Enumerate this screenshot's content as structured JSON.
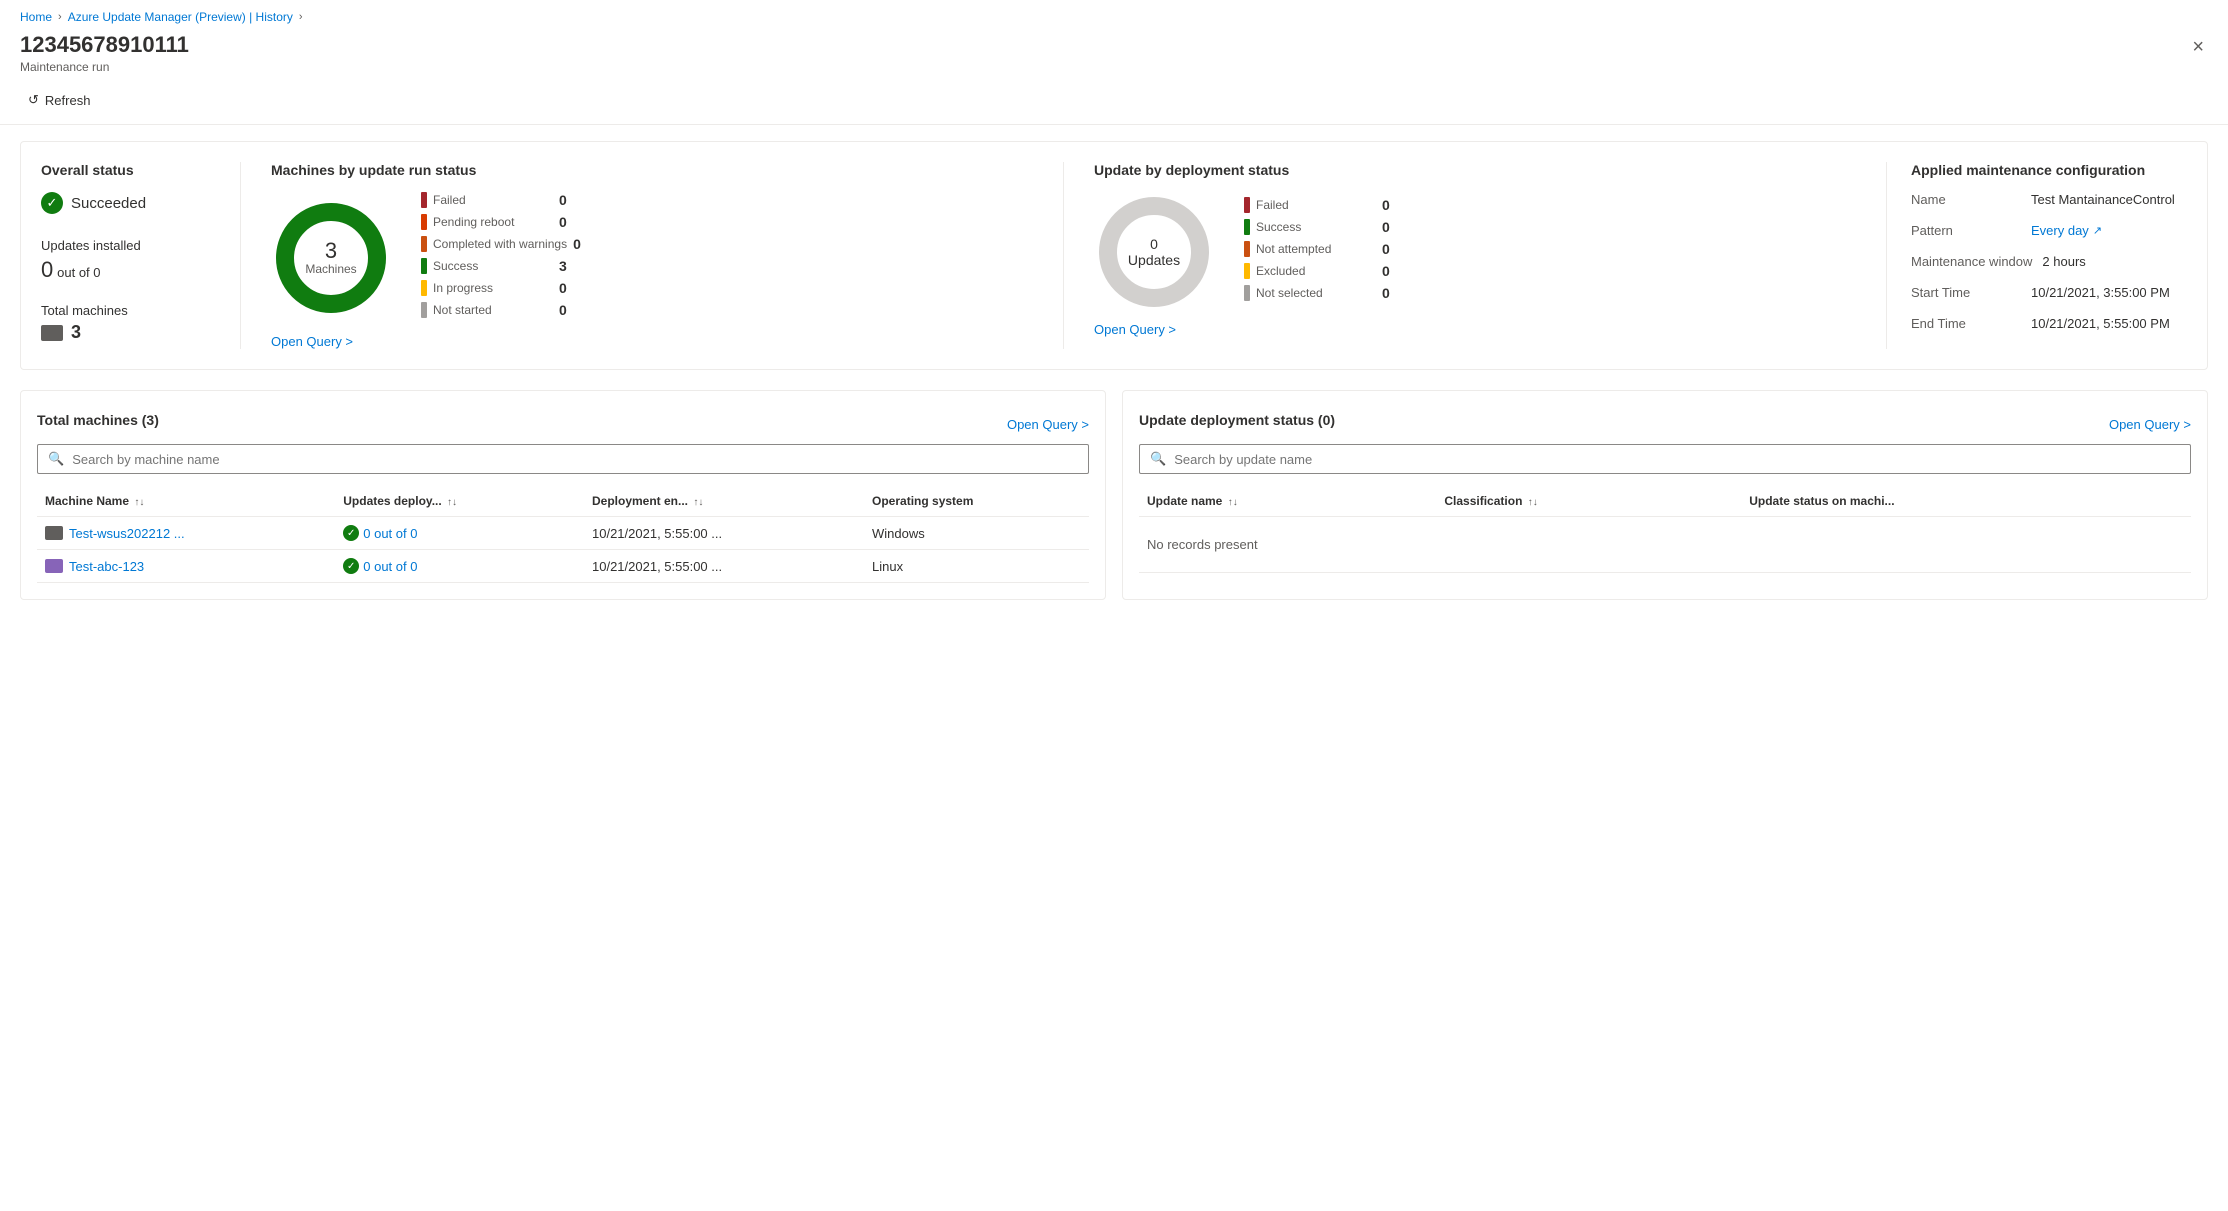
{
  "breadcrumb": {
    "home": "Home",
    "parent": "Azure Update Manager (Preview) | History"
  },
  "header": {
    "title": "12345678910111",
    "subtitle": "Maintenance run",
    "close_label": "×"
  },
  "toolbar": {
    "refresh_label": "Refresh"
  },
  "overall_status": {
    "section_title": "Overall status",
    "status_text": "Succeeded",
    "updates_installed_label": "Updates installed",
    "updates_count": "0",
    "updates_out_of": "out of 0",
    "total_machines_label": "Total machines",
    "total_machines_count": "3"
  },
  "machines_by_status": {
    "section_title": "Machines by update run status",
    "donut_center_num": "3",
    "donut_center_text": "Machines",
    "statuses": [
      {
        "label": "Failed",
        "count": "0",
        "color": "red"
      },
      {
        "label": "Pending reboot",
        "count": "0",
        "color": "orange"
      },
      {
        "label": "Completed with warnings",
        "count": "0",
        "color": "orange2"
      },
      {
        "label": "Success",
        "count": "3",
        "color": "green"
      },
      {
        "label": "In progress",
        "count": "0",
        "color": "yellow"
      },
      {
        "label": "Not started",
        "count": "0",
        "color": "gray"
      }
    ],
    "open_query_label": "Open Query >"
  },
  "update_deployment_status": {
    "section_title": "Update by deployment status",
    "donut_center_text": "0 Updates",
    "statuses": [
      {
        "label": "Failed",
        "count": "0",
        "color": "red"
      },
      {
        "label": "Success",
        "count": "0",
        "color": "green"
      },
      {
        "label": "Not attempted",
        "count": "0",
        "color": "orange2"
      },
      {
        "label": "Excluded",
        "count": "0",
        "color": "yellow"
      },
      {
        "label": "Not selected",
        "count": "0",
        "color": "gray"
      }
    ],
    "open_query_label": "Open Query >"
  },
  "applied_config": {
    "section_title": "Applied maintenance configuration",
    "name_label": "Name",
    "name_bold": "Test",
    "name_value": "MantainanceControl",
    "pattern_label": "Pattern",
    "pattern_value": "Every day",
    "maintenance_window_label": "Maintenance window",
    "maintenance_window_value": "2 hours",
    "start_time_label": "Start Time",
    "start_time_value": "10/21/2021, 3:55:00 PM",
    "end_time_label": "End Time",
    "end_time_value": "10/21/2021, 5:55:00 PM"
  },
  "total_machines_panel": {
    "title": "Total machines (3)",
    "open_query_label": "Open Query >",
    "search_placeholder": "Search by machine name",
    "columns": [
      "Machine Name",
      "Updates deploy...",
      "Deployment en...",
      "Operating system"
    ],
    "rows": [
      {
        "name": "Test-wsus202212 ...",
        "updates": "0 out of 0",
        "deployment_end": "10/21/2021, 5:55:00 ...",
        "os": "Windows"
      },
      {
        "name": "Test-abc-123",
        "updates": "0 out of 0",
        "deployment_end": "10/21/2021, 5:55:00 ...",
        "os": "Linux"
      }
    ]
  },
  "update_deployment_panel": {
    "title": "Update deployment status (0)",
    "open_query_label": "Open Query >",
    "search_placeholder": "Search by update name",
    "columns": [
      "Update name",
      "Classification",
      "Update status on machi..."
    ],
    "no_records_text": "No records present"
  }
}
